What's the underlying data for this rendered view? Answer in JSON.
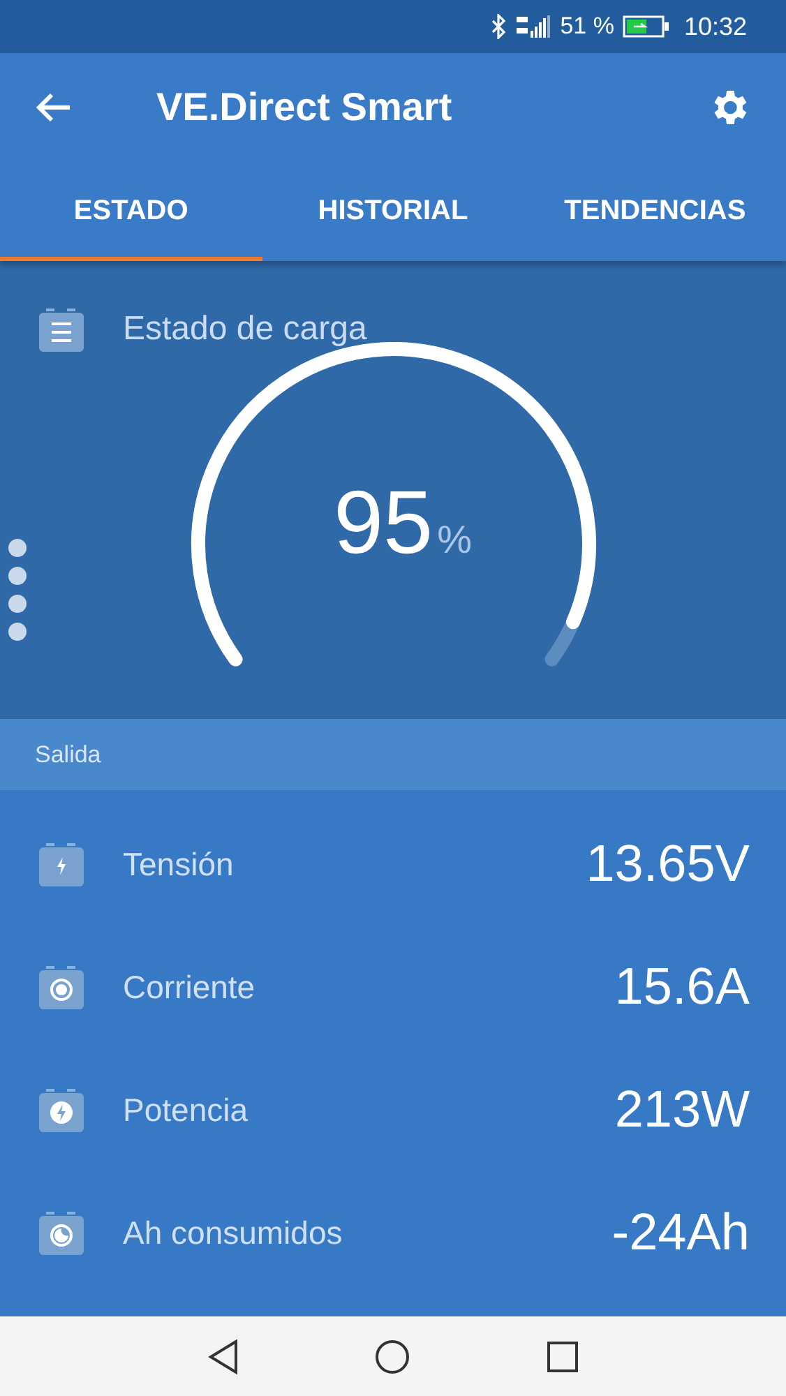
{
  "status_bar": {
    "battery": "51 %",
    "time": "10:32"
  },
  "app_bar": {
    "title": "VE.Direct Smart"
  },
  "tabs": [
    {
      "label": "ESTADO",
      "selected": true
    },
    {
      "label": "HISTORIAL",
      "selected": false
    },
    {
      "label": "TENDENCIAS",
      "selected": false
    }
  ],
  "gauge": {
    "title": "Estado de carga",
    "value": "95",
    "unit": "%"
  },
  "section": {
    "title": "Salida"
  },
  "metrics": [
    {
      "kind": "bolt",
      "label": "Tensión",
      "value": "13.65V"
    },
    {
      "kind": "dot",
      "label": "Corriente",
      "value": "15.6A"
    },
    {
      "kind": "bolt-circle",
      "label": "Potencia",
      "value": "213W"
    },
    {
      "kind": "moon",
      "label": "Ah consumidos",
      "value": "-24Ah"
    }
  ]
}
